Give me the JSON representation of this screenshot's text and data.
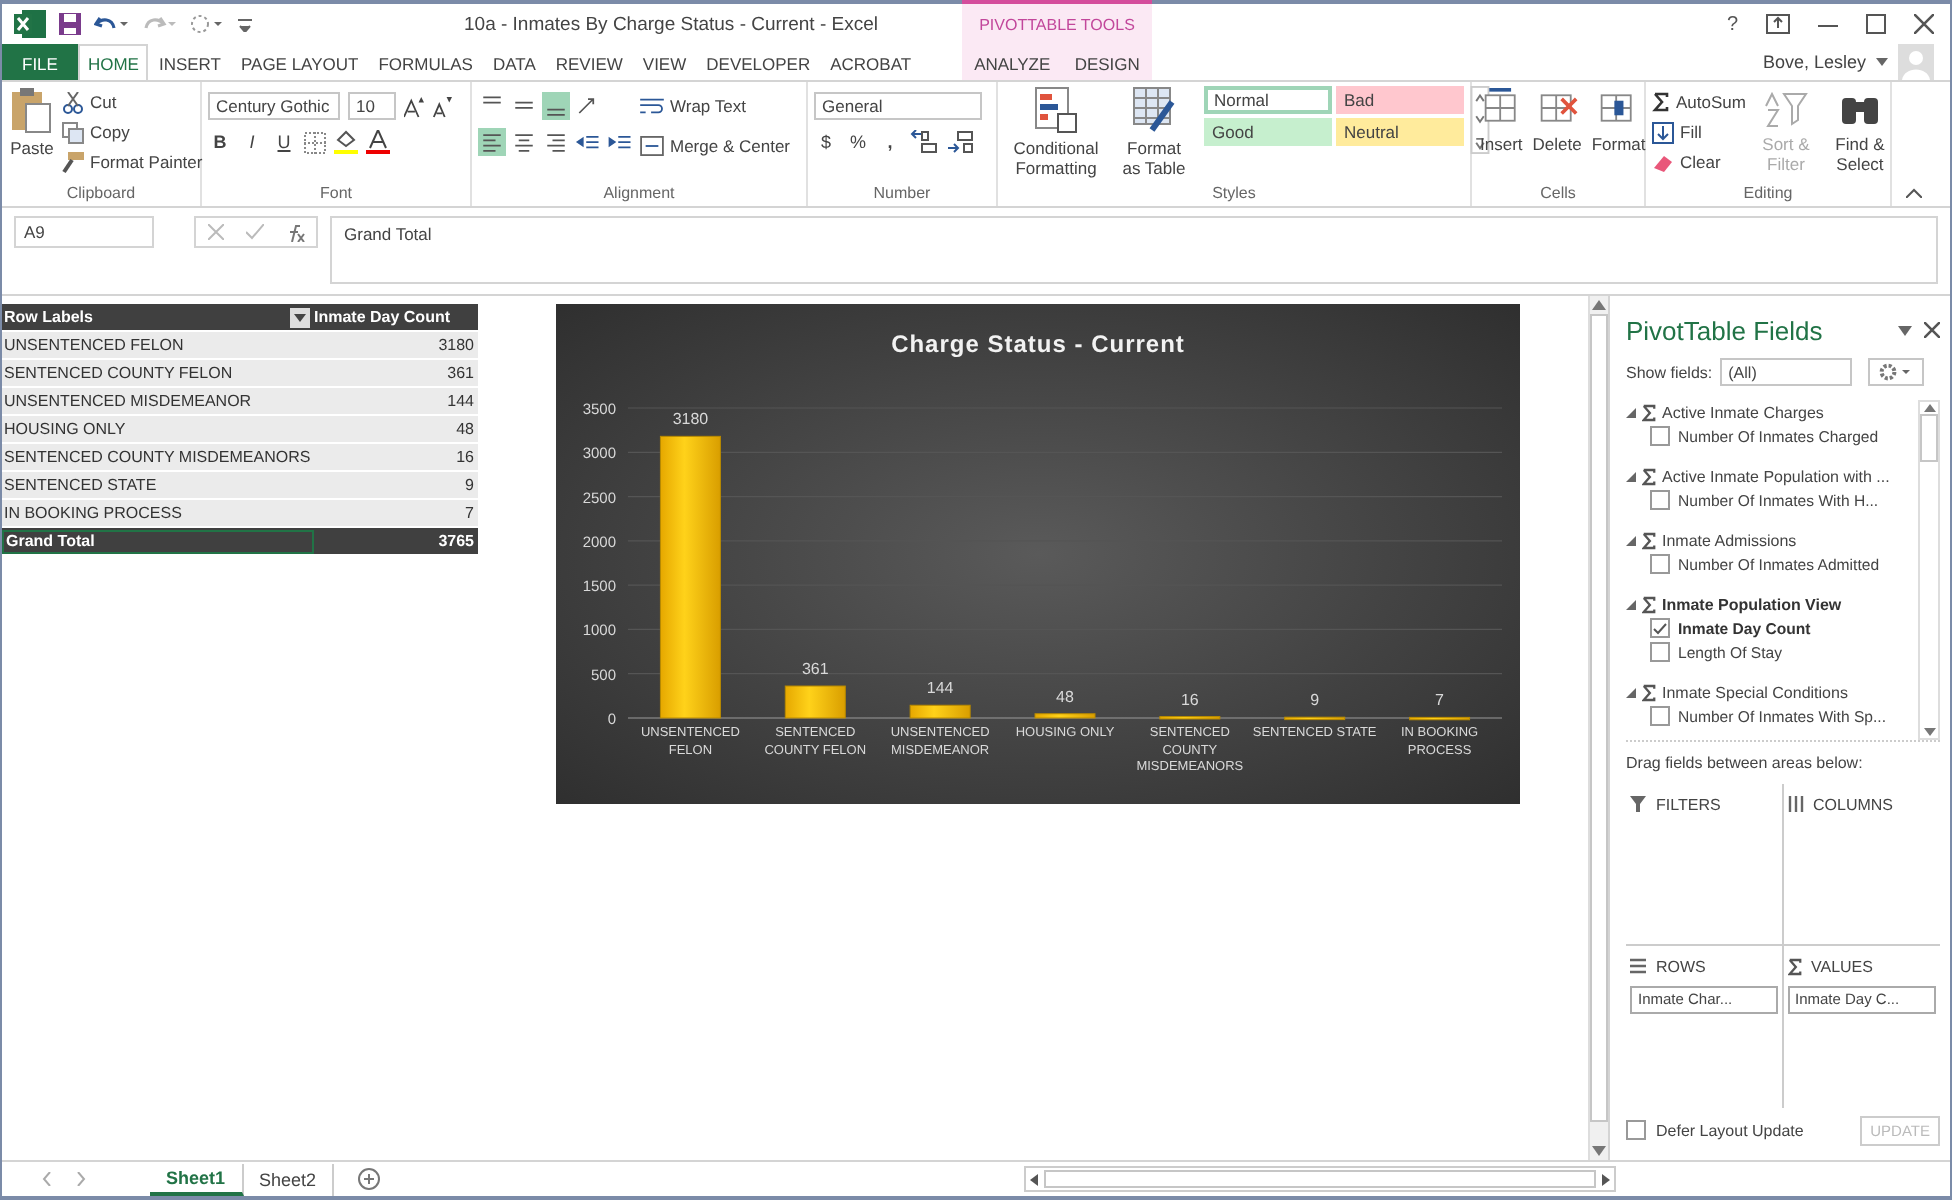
{
  "window": {
    "title": "10a - Inmates By Charge Status - Current - Excel",
    "help": "?"
  },
  "context_tabs": {
    "label": "PIVOTTABLE TOOLS",
    "tabs": [
      {
        "label": "ANALYZE",
        "selected": false
      },
      {
        "label": "DESIGN",
        "selected": false
      }
    ]
  },
  "tabs": [
    {
      "label": "FILE",
      "kind": "file",
      "selected": false
    },
    {
      "label": "HOME",
      "kind": "normal",
      "selected": true
    },
    {
      "label": "INSERT",
      "kind": "normal",
      "selected": false
    },
    {
      "label": "PAGE LAYOUT",
      "kind": "normal",
      "selected": false
    },
    {
      "label": "FORMULAS",
      "kind": "normal",
      "selected": false
    },
    {
      "label": "DATA",
      "kind": "normal",
      "selected": false
    },
    {
      "label": "REVIEW",
      "kind": "normal",
      "selected": false
    },
    {
      "label": "VIEW",
      "kind": "normal",
      "selected": false
    },
    {
      "label": "DEVELOPER",
      "kind": "normal",
      "selected": false
    },
    {
      "label": "ACROBAT",
      "kind": "normal",
      "selected": false
    }
  ],
  "user": "Bove, Lesley",
  "ribbon": {
    "clipboard": {
      "label": "Clipboard",
      "paste": "Paste",
      "cut": "Cut",
      "copy": "Copy",
      "format_painter": "Format Painter"
    },
    "font": {
      "label": "Font",
      "name": "Century Gothic",
      "size": "10",
      "bold": "B",
      "italic": "I",
      "underline": "U"
    },
    "alignment": {
      "label": "Alignment",
      "vertical": [
        {
          "selected": false
        },
        {
          "selected": false
        },
        {
          "selected": true
        }
      ],
      "horizontal": [
        {
          "selected": true
        },
        {
          "selected": false
        },
        {
          "selected": false
        }
      ],
      "wrap_text": "Wrap Text",
      "merge_center": "Merge & Center"
    },
    "number": {
      "label": "Number",
      "format": "General",
      "currency": "$",
      "percent": "%",
      "comma": ","
    },
    "styles": {
      "label": "Styles",
      "conditional_formatting": "Conditional Formatting",
      "format_as_table": "Format as Table",
      "cell_styles": [
        {
          "label": "Normal",
          "color": "#ffffff",
          "selected": true
        },
        {
          "label": "Bad",
          "color": "#ffc7ce",
          "selected": false
        },
        {
          "label": "Good",
          "color": "#c6efce",
          "selected": false
        },
        {
          "label": "Neutral",
          "color": "#ffeb9c",
          "selected": false
        }
      ]
    },
    "cells": {
      "label": "Cells",
      "buttons": [
        "Insert",
        "Delete",
        "Format"
      ]
    },
    "editing": {
      "label": "Editing",
      "autosum": "AutoSum",
      "fill": "Fill",
      "clear": "Clear",
      "sort_filter": {
        "label": "Sort & Filter",
        "disabled": true
      },
      "find_select": "Find & Select"
    }
  },
  "formula_bar": {
    "name_box": "A9",
    "formula": "Grand Total"
  },
  "pivot_table": {
    "columns": [
      "Row Labels",
      "Inmate Day Count"
    ],
    "rows": [
      {
        "label": "UNSENTENCED FELON",
        "value": "3180"
      },
      {
        "label": "SENTENCED COUNTY FELON",
        "value": "361"
      },
      {
        "label": "UNSENTENCED MISDEMEANOR",
        "value": "144"
      },
      {
        "label": "HOUSING ONLY",
        "value": "48"
      },
      {
        "label": "SENTENCED COUNTY MISDEMEANORS",
        "value": "16"
      },
      {
        "label": "SENTENCED STATE",
        "value": "9"
      },
      {
        "label": "IN BOOKING PROCESS",
        "value": "7"
      }
    ],
    "total": {
      "label": "Grand Total",
      "value": "3765"
    }
  },
  "chart": {
    "chart_data": {
      "type": "bar",
      "title": "Charge Status - Current",
      "categories": [
        "UNSENTENCED FELON",
        "SENTENCED COUNTY FELON",
        "UNSENTENCED MISDEMEANOR",
        "HOUSING ONLY",
        "SENTENCED COUNTY MISDEMEANORS",
        "SENTENCED STATE",
        "IN BOOKING PROCESS"
      ],
      "values": [
        3180,
        361,
        144,
        48,
        16,
        9,
        7
      ],
      "ylim": [
        0,
        3500
      ],
      "grid": true,
      "yticks": [
        0,
        500,
        1000,
        1500,
        2000,
        2500,
        3000,
        3500
      ],
      "data_labels": true
    }
  },
  "pivot_fields": {
    "title": "PivotTable Fields",
    "show_fields_label": "Show fields:",
    "show_fields_value": "(All)",
    "tables": [
      {
        "name": "Active Inmate Charges",
        "active": false,
        "fields": [
          {
            "label": "Number Of Inmates Charged",
            "checked": false
          }
        ]
      },
      {
        "name": "Active Inmate Population with ...",
        "active": false,
        "fields": [
          {
            "label": "Number Of Inmates With H...",
            "checked": false
          }
        ]
      },
      {
        "name": "Inmate Admissions",
        "active": false,
        "fields": [
          {
            "label": "Number Of Inmates Admitted",
            "checked": false
          }
        ]
      },
      {
        "name": "Inmate Population View",
        "active": true,
        "fields": [
          {
            "label": "Inmate Day Count",
            "checked": true
          },
          {
            "label": "Length Of Stay",
            "checked": false
          }
        ]
      },
      {
        "name": "Inmate Special Conditions",
        "active": false,
        "fields": [
          {
            "label": "Number Of Inmates With Sp...",
            "checked": false
          }
        ]
      }
    ],
    "areas_hint": "Drag fields between areas below:",
    "areas": [
      {
        "label": "FILTERS",
        "kind": "filters"
      },
      {
        "label": "COLUMNS",
        "kind": "columns"
      },
      {
        "label": "ROWS",
        "kind": "rows",
        "items": [
          "Inmate Char..."
        ]
      },
      {
        "label": "VALUES",
        "kind": "values",
        "items": [
          "Inmate Day C..."
        ]
      }
    ],
    "defer": {
      "label": "Defer Layout Update",
      "checked": false
    },
    "update": {
      "label": "UPDATE",
      "disabled": true
    }
  },
  "sheets": [
    {
      "label": "Sheet1",
      "selected": true
    },
    {
      "label": "Sheet2",
      "selected": false
    }
  ]
}
